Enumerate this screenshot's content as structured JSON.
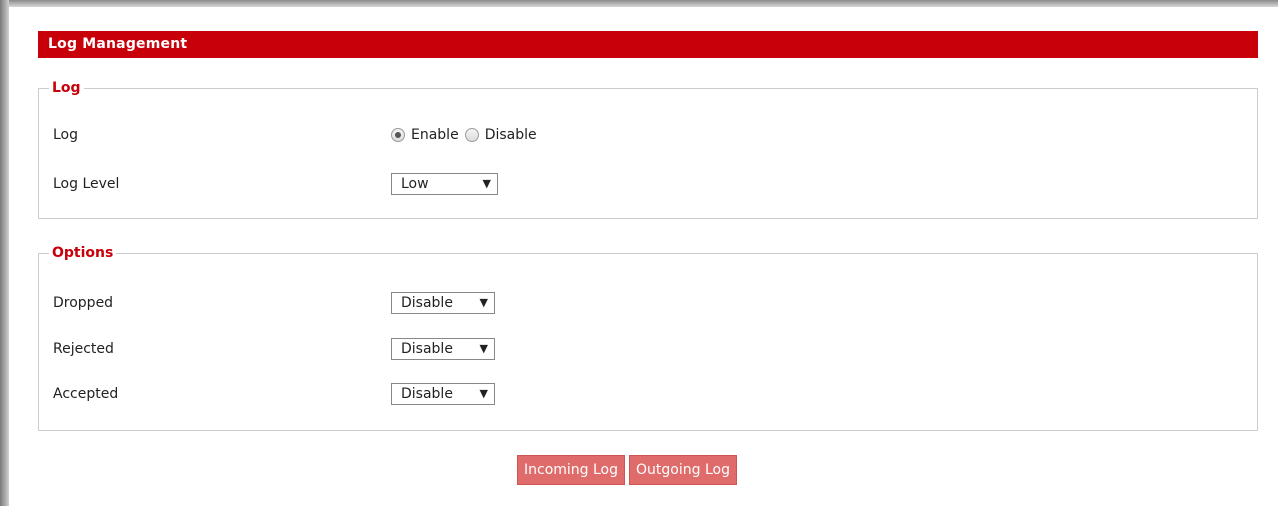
{
  "header": {
    "title": "Log Management"
  },
  "log_section": {
    "legend": "Log",
    "log_row": {
      "label": "Log",
      "options": [
        "Enable",
        "Disable"
      ],
      "selected": "Enable"
    },
    "level_row": {
      "label": "Log Level",
      "value": "Low"
    }
  },
  "options_section": {
    "legend": "Options",
    "rows": [
      {
        "label": "Dropped",
        "value": "Disable"
      },
      {
        "label": "Rejected",
        "value": "Disable"
      },
      {
        "label": "Accepted",
        "value": "Disable"
      }
    ]
  },
  "buttons": {
    "incoming": "Incoming Log",
    "outgoing": "Outgoing Log"
  },
  "colors": {
    "accent": "#c8000a",
    "button": "#e06b6b"
  },
  "icons": {
    "dropdown": "▼"
  }
}
